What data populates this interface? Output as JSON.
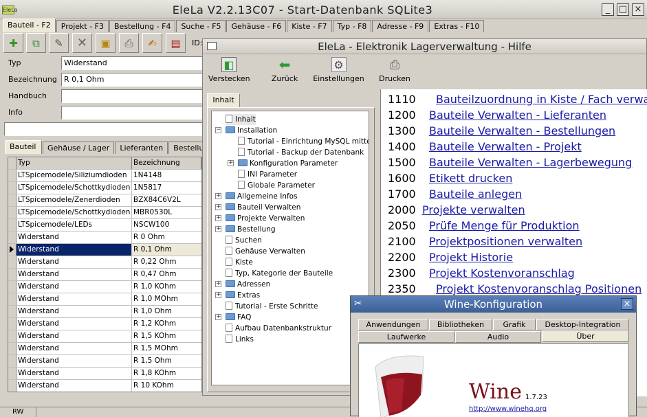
{
  "main": {
    "app_icon_text": "EleLa",
    "title": "EleLa V2.2.13C07  - Start-Datenbank SQLite3",
    "tabs": [
      "Bauteil - F2",
      "Projekt - F3",
      "Bestellung - F4",
      "Suche - F5",
      "Gehäuse - F6",
      "Kiste - F7",
      "Typ - F8",
      "Adresse - F9",
      "Extras - F10"
    ],
    "id_label": "ID:",
    "fields": {
      "typ_label": "Typ",
      "typ_value": "Widerstand",
      "bezeichnung_label": "Bezeichnung",
      "bezeichnung_value": "R 0,1 Ohm",
      "handbuch_label": "Handbuch",
      "handbuch_value": "",
      "info_label": "Info",
      "info_value": ""
    },
    "subtabs": [
      "Bauteil",
      "Gehäuse / Lager",
      "Lieferanten",
      "Bestellung"
    ],
    "grid": {
      "headers": [
        "Typ",
        "Bezeichnung"
      ],
      "rows": [
        [
          "LTSpicemodele/Siliziumdioden",
          "1N4148"
        ],
        [
          "LTSpicemodele/Schottkydioden",
          "1N5817"
        ],
        [
          "LTSpicemodele/Zenerdioden",
          "BZX84C6V2L"
        ],
        [
          "LTSpicemodele/Schottkydioden",
          "MBR0530L"
        ],
        [
          "LTSpicemodele/LEDs",
          "NSCW100"
        ],
        [
          "Widerstand",
          "R 0 Ohm"
        ],
        [
          "Widerstand",
          "R 0,1 Ohm"
        ],
        [
          "Widerstand",
          "R 0,22 Ohm"
        ],
        [
          "Widerstand",
          "R 0,47 Ohm"
        ],
        [
          "Widerstand",
          "R 1,0 KOhm"
        ],
        [
          "Widerstand",
          "R 1,0 MOhm"
        ],
        [
          "Widerstand",
          "R 1,0 Ohm"
        ],
        [
          "Widerstand",
          "R 1,2 KOhm"
        ],
        [
          "Widerstand",
          "R 1,5 KOhm"
        ],
        [
          "Widerstand",
          "R 1,5 MOhm"
        ],
        [
          "Widerstand",
          "R 1,5 Ohm"
        ],
        [
          "Widerstand",
          "R 1,8 KOhm"
        ],
        [
          "Widerstand",
          "R 10 KOhm"
        ]
      ],
      "selected_row": 6
    },
    "status": "RW"
  },
  "help": {
    "title": "EleLa - Elektronik Lagerverwaltung - Hilfe",
    "toolbar": [
      "Verstecken",
      "Zurück",
      "Einstellungen",
      "Drucken"
    ],
    "tab": "Inhalt",
    "tree": [
      "Inhalt",
      "Installation",
      "Tutorial - Einrichtung MySQL mittels",
      "Tutorial - Backup der Datenbank",
      "Konfiguration Parameter",
      "INI Parameter",
      "Globale Parameter",
      "Allgemeine Infos",
      "Bauteil Verwalten",
      "Projekte Verwalten",
      "Bestellung",
      "Suchen",
      "Gehäuse Verwalten",
      "Kiste",
      "Typ, Kategorie der Bauteile",
      "Adressen",
      "Extras",
      "Tutorial - Erste Schritte",
      "FAQ",
      "Aufbau Datenbankstruktur",
      "Links"
    ],
    "content": [
      {
        "num": "1110",
        "text": "Bauteilzuordnung in Kiste / Fach verwalten"
      },
      {
        "num": "1200",
        "text": "Bauteile Verwalten - Lieferanten"
      },
      {
        "num": "1300",
        "text": "Bauteile Verwalten - Bestellungen"
      },
      {
        "num": "1400",
        "text": "Bauteile Verwalten - Projekt"
      },
      {
        "num": "1500",
        "text": "Bauteile Verwalten - Lagerbewegung"
      },
      {
        "num": "1600",
        "text": "Etikett drucken"
      },
      {
        "num": "1700",
        "text": "Bauteile anlegen"
      },
      {
        "num": "2000",
        "text": "Projekte verwalten"
      },
      {
        "num": "2050",
        "text": "Prüfe Menge für Produktion"
      },
      {
        "num": "2100",
        "text": "Projektpositionen verwalten"
      },
      {
        "num": "2200",
        "text": "Projekt Historie"
      },
      {
        "num": "2300",
        "text": "Projekt Kostenvoranschlag"
      },
      {
        "num": "2350",
        "text": "Projekt Kostenvoranschlag Positionen"
      }
    ]
  },
  "wine": {
    "title": "Wine-Konfiguration",
    "tabs_row1": [
      "Anwendungen",
      "Bibliotheken",
      "Grafik",
      "Desktop-Integration"
    ],
    "tabs_row2": [
      "Laufwerke",
      "Audio",
      "Über"
    ],
    "brand": "Wine",
    "version": "1.7.23",
    "url": "http://www.winehq.org"
  }
}
